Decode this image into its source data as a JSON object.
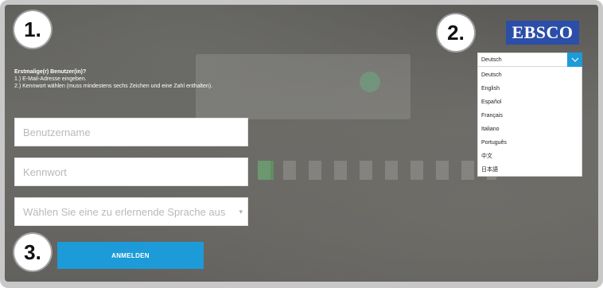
{
  "steps": {
    "one": "1.",
    "two": "2.",
    "three": "3."
  },
  "logo": {
    "text": "EBSCO",
    "color": "#2b4ea8"
  },
  "intro": {
    "title": "Erstmalige(r) Benutzer(in)?",
    "step1": "1.) E-Mail-Adresse eingeben.",
    "step2": "2.) Kennwort wählen (muss mindestens sechs Zeichen und eine Zahl enthalten)."
  },
  "form": {
    "username_placeholder": "Benutzername",
    "password_placeholder": "Kennwort",
    "language_placeholder": "Wählen Sie eine zu erlernende Sprache aus",
    "login_label": "ANMELDEN"
  },
  "language_select": {
    "selected": "Deutsch",
    "options": [
      "Deutsch",
      "English",
      "Español",
      "Français",
      "Italiano",
      "Português",
      "中文",
      "日本語"
    ]
  },
  "colors": {
    "accent": "#1d9bd8"
  },
  "icons": {
    "dropdown": "chevron-down-icon",
    "select_caret": "caret-down-icon"
  }
}
